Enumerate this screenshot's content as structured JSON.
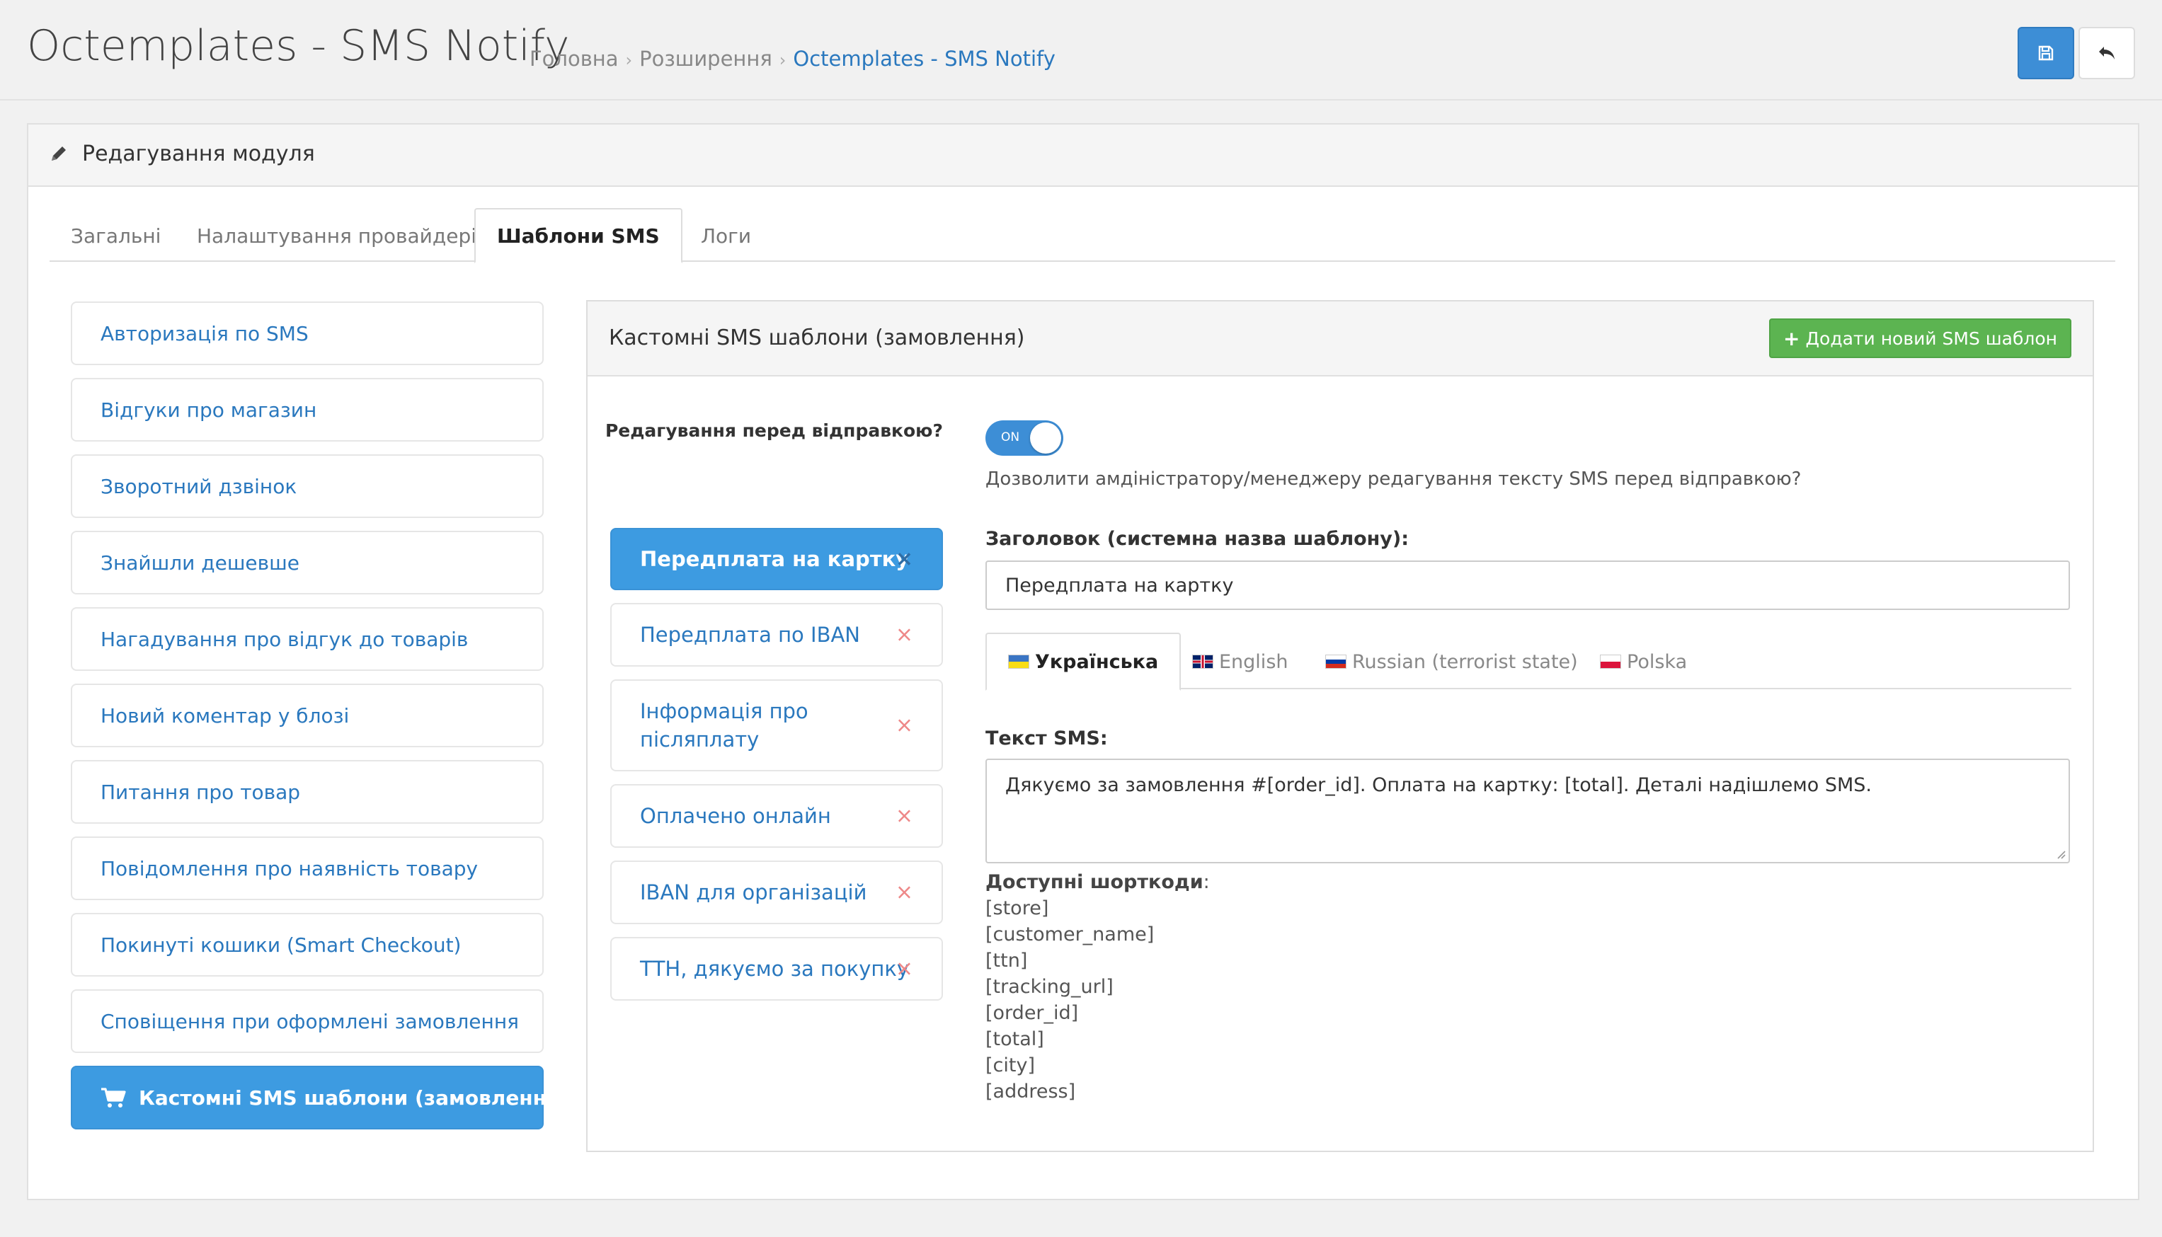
{
  "header": {
    "title": "Octemplates - SMS Notify",
    "breadcrumb": [
      "Головна",
      "Розширення",
      "Octemplates - SMS Notify"
    ],
    "separator": "›",
    "save_icon": "save-icon",
    "back_icon": "reply-icon"
  },
  "panel": {
    "title": "Редагування модуля",
    "icon": "pencil-icon"
  },
  "tabs": [
    "Загальні",
    "Налаштування провайдерів",
    "Шаблони SMS",
    "Логи"
  ],
  "sidebar": {
    "items": [
      "Авторизація по SMS",
      "Відгуки про магазин",
      "Зворотний дзвінок",
      "Знайшли дешевше",
      "Нагадування про відгук до товарів",
      "Новий коментар у блозі",
      "Питання про товар",
      "Повідомлення про наявність товару",
      "Покинуті кошики (Smart Checkout)",
      "Сповіщення при оформлені замовлення",
      "Кастомні SMS шаблони (замовлення)"
    ],
    "active_icon": "cart-icon"
  },
  "content": {
    "title": "Кастомні SMS шаблони (замовлення)",
    "add_button": "Додати новий SMS шаблон",
    "add_icon": "+",
    "edit_label": "Редагування перед відправкою?",
    "toggle_label": "ON",
    "toggle_state": "on",
    "help": "Дозволити амдіністратору/менеджеру редагування тексту SMS перед відправкою?",
    "templates": [
      "Передплата на картку",
      "Передплата по IBAN",
      "Інформація про післяплату",
      "Оплачено онлайн",
      "IBAN для організацій",
      "ТТН, дякуємо за покупку"
    ],
    "remove_icon": "×",
    "title_label": "Заголовок (системна назва шаблону):",
    "title_value": "Передплата на картку",
    "languages": [
      "Українська",
      "English",
      "Russian (terrorist state)",
      "Polska"
    ],
    "sms_label": "Текст SMS:",
    "sms_text": "Дякуємо за замовлення #[order_id]. Оплата на картку: [total]. Деталі надішлемо SMS.",
    "shortcodes_label": "Доступні шорткоди",
    "shortcodes": [
      "[store]",
      "[customer_name]",
      "[ttn]",
      "[tracking_url]",
      "[order_id]",
      "[total]",
      "[city]",
      "[address]"
    ]
  },
  "colors": {
    "primary": "#3d9be1",
    "link": "#2a78be",
    "success": "#5cb451",
    "danger_x": "#e88888"
  }
}
